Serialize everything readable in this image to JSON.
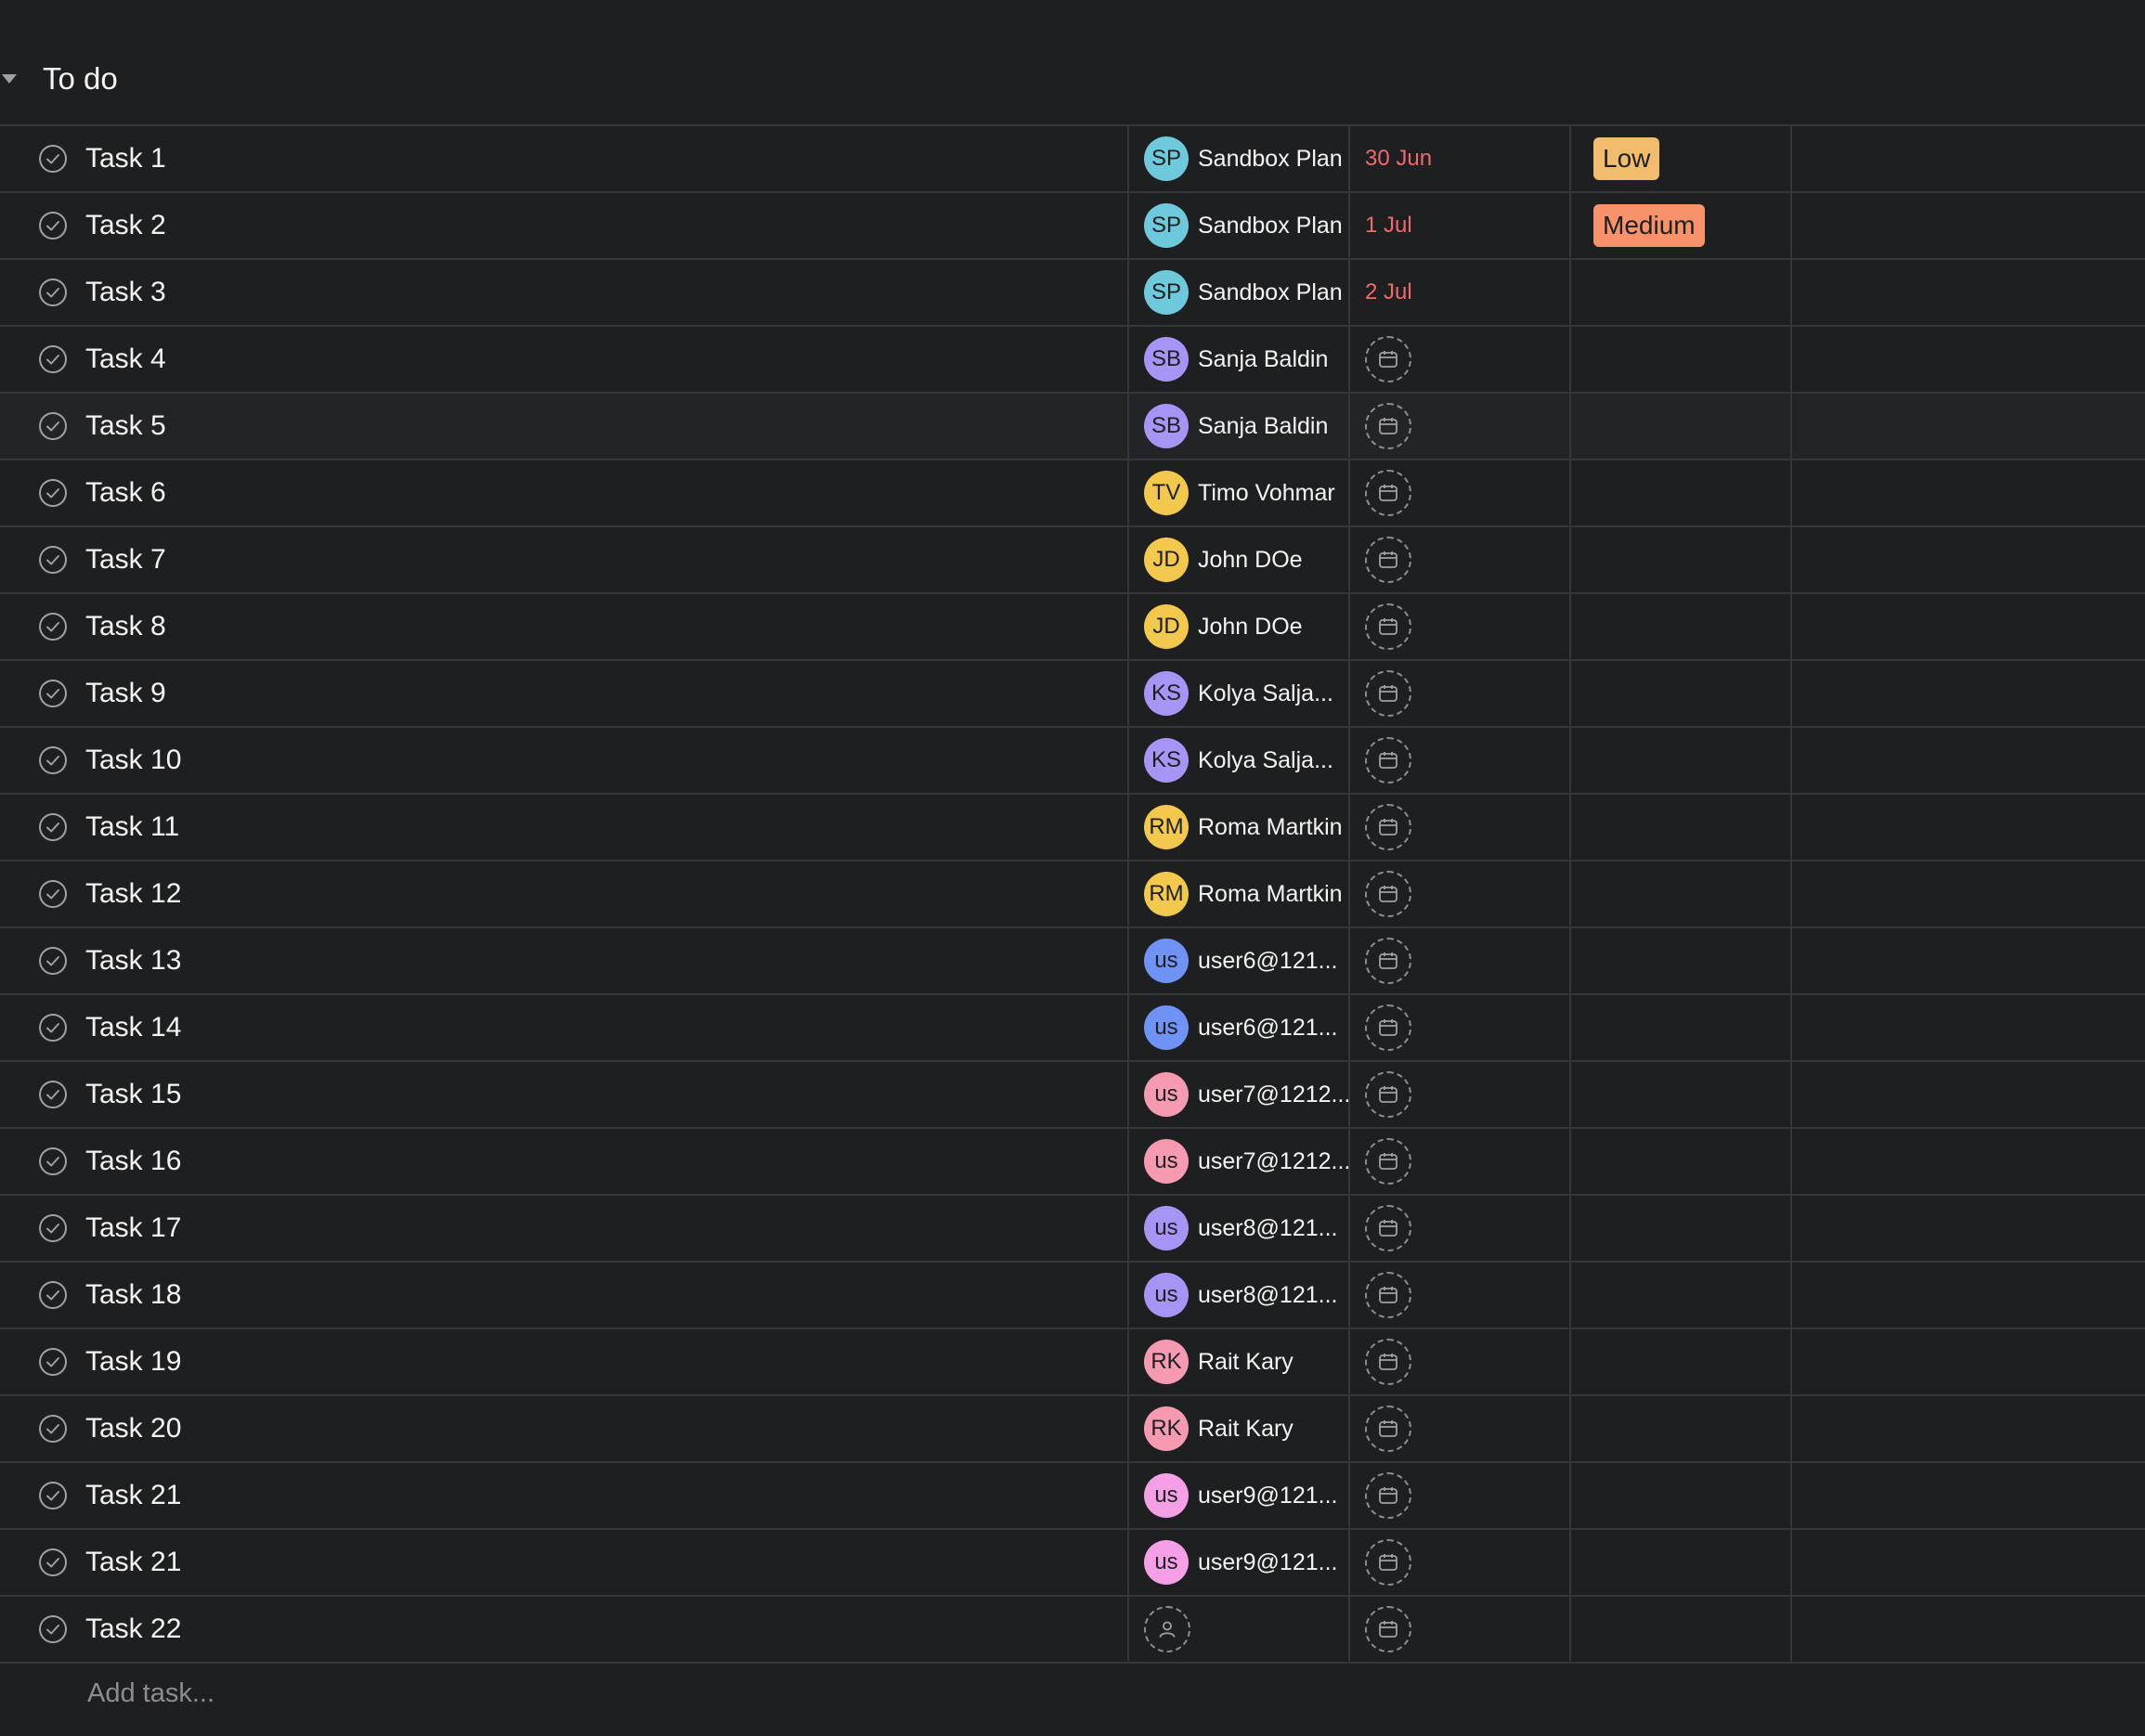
{
  "section": {
    "title": "To do"
  },
  "add_task_placeholder": "Add task...",
  "icons": {
    "collapse": "caret-down-icon",
    "complete": "checkmark-circle-icon",
    "no_assignee": "person-icon",
    "no_due_date": "calendar-icon"
  },
  "colors": {
    "background": "#1e1f21",
    "divider": "#353638",
    "overdue": "#f06a6a",
    "priority_low": "#f1bd6c",
    "priority_medium": "#f8926a"
  },
  "tasks": [
    {
      "name": "Task 1",
      "assignee": "Sandbox Plan",
      "initials": "SP",
      "avatar_color": "#6ec9dc",
      "due": "30 Jun",
      "priority": "Low",
      "priority_color": "#f1bd6c"
    },
    {
      "name": "Task 2",
      "assignee": "Sandbox Plan",
      "initials": "SP",
      "avatar_color": "#6ec9dc",
      "due": "1 Jul",
      "priority": "Medium",
      "priority_color": "#f8926a"
    },
    {
      "name": "Task 3",
      "assignee": "Sandbox Plan",
      "initials": "SP",
      "avatar_color": "#6ec9dc",
      "due": "2 Jul",
      "priority": ""
    },
    {
      "name": "Task 4",
      "assignee": "Sanja Baldin",
      "initials": "SB",
      "avatar_color": "#a894f5",
      "due": "",
      "priority": ""
    },
    {
      "name": "Task 5",
      "assignee": "Sanja Baldin",
      "initials": "SB",
      "avatar_color": "#a894f5",
      "due": "",
      "priority": ""
    },
    {
      "name": "Task 6",
      "assignee": "Timo Vohmar",
      "initials": "TV",
      "avatar_color": "#f2c94c",
      "due": "",
      "priority": ""
    },
    {
      "name": "Task 7",
      "assignee": "John DOe",
      "initials": "JD",
      "avatar_color": "#f2c94c",
      "due": "",
      "priority": ""
    },
    {
      "name": "Task 8",
      "assignee": "John DOe",
      "initials": "JD",
      "avatar_color": "#f2c94c",
      "due": "",
      "priority": ""
    },
    {
      "name": "Task 9",
      "assignee": "Kolya Salja...",
      "initials": "KS",
      "avatar_color": "#a894f5",
      "due": "",
      "priority": ""
    },
    {
      "name": "Task 10",
      "assignee": "Kolya Salja...",
      "initials": "KS",
      "avatar_color": "#a894f5",
      "due": "",
      "priority": ""
    },
    {
      "name": "Task 11",
      "assignee": "Roma Martkin",
      "initials": "RM",
      "avatar_color": "#f2c94c",
      "due": "",
      "priority": ""
    },
    {
      "name": "Task 12",
      "assignee": "Roma Martkin",
      "initials": "RM",
      "avatar_color": "#f2c94c",
      "due": "",
      "priority": ""
    },
    {
      "name": "Task 13",
      "assignee": "user6@121...",
      "initials": "us",
      "avatar_color": "#6e93f5",
      "due": "",
      "priority": ""
    },
    {
      "name": "Task 14",
      "assignee": "user6@121...",
      "initials": "us",
      "avatar_color": "#6e93f5",
      "due": "",
      "priority": ""
    },
    {
      "name": "Task 15",
      "assignee": "user7@1212...",
      "initials": "us",
      "avatar_color": "#f59ab0",
      "due": "",
      "priority": ""
    },
    {
      "name": "Task 16",
      "assignee": "user7@1212...",
      "initials": "us",
      "avatar_color": "#f59ab0",
      "due": "",
      "priority": ""
    },
    {
      "name": "Task 17",
      "assignee": "user8@121...",
      "initials": "us",
      "avatar_color": "#a894f5",
      "due": "",
      "priority": ""
    },
    {
      "name": "Task 18",
      "assignee": "user8@121...",
      "initials": "us",
      "avatar_color": "#a894f5",
      "due": "",
      "priority": ""
    },
    {
      "name": "Task 19",
      "assignee": "Rait Kary",
      "initials": "RK",
      "avatar_color": "#f59ab0",
      "due": "",
      "priority": ""
    },
    {
      "name": "Task 20",
      "assignee": "Rait Kary",
      "initials": "RK",
      "avatar_color": "#f59ab0",
      "due": "",
      "priority": ""
    },
    {
      "name": "Task 21",
      "assignee": "user9@121...",
      "initials": "us",
      "avatar_color": "#f5a0e6",
      "due": "",
      "priority": ""
    },
    {
      "name": "Task 21",
      "assignee": "user9@121...",
      "initials": "us",
      "avatar_color": "#f5a0e6",
      "due": "",
      "priority": ""
    },
    {
      "name": "Task 22",
      "assignee": "",
      "initials": "",
      "avatar_color": "",
      "due": "",
      "priority": ""
    }
  ]
}
